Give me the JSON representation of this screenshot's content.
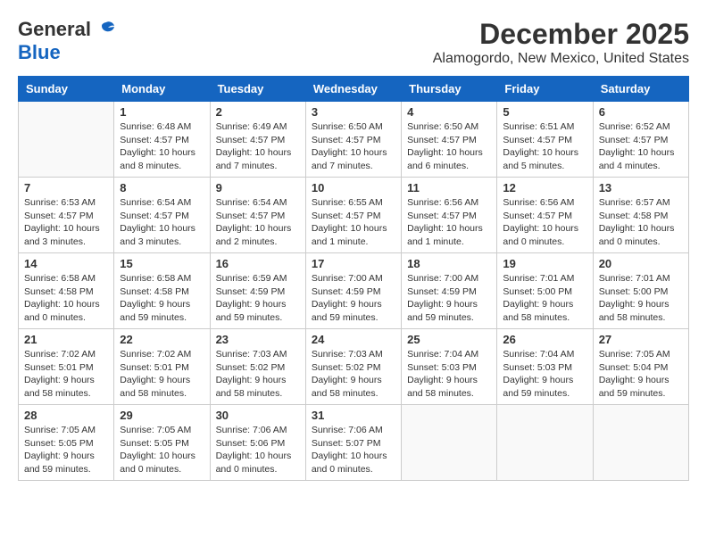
{
  "header": {
    "logo_general": "General",
    "logo_blue": "Blue",
    "month": "December 2025",
    "location": "Alamogordo, New Mexico, United States"
  },
  "days_of_week": [
    "Sunday",
    "Monday",
    "Tuesday",
    "Wednesday",
    "Thursday",
    "Friday",
    "Saturday"
  ],
  "weeks": [
    [
      {
        "day": "",
        "info": ""
      },
      {
        "day": "1",
        "info": "Sunrise: 6:48 AM\nSunset: 4:57 PM\nDaylight: 10 hours\nand 8 minutes."
      },
      {
        "day": "2",
        "info": "Sunrise: 6:49 AM\nSunset: 4:57 PM\nDaylight: 10 hours\nand 7 minutes."
      },
      {
        "day": "3",
        "info": "Sunrise: 6:50 AM\nSunset: 4:57 PM\nDaylight: 10 hours\nand 7 minutes."
      },
      {
        "day": "4",
        "info": "Sunrise: 6:50 AM\nSunset: 4:57 PM\nDaylight: 10 hours\nand 6 minutes."
      },
      {
        "day": "5",
        "info": "Sunrise: 6:51 AM\nSunset: 4:57 PM\nDaylight: 10 hours\nand 5 minutes."
      },
      {
        "day": "6",
        "info": "Sunrise: 6:52 AM\nSunset: 4:57 PM\nDaylight: 10 hours\nand 4 minutes."
      }
    ],
    [
      {
        "day": "7",
        "info": "Sunrise: 6:53 AM\nSunset: 4:57 PM\nDaylight: 10 hours\nand 3 minutes."
      },
      {
        "day": "8",
        "info": "Sunrise: 6:54 AM\nSunset: 4:57 PM\nDaylight: 10 hours\nand 3 minutes."
      },
      {
        "day": "9",
        "info": "Sunrise: 6:54 AM\nSunset: 4:57 PM\nDaylight: 10 hours\nand 2 minutes."
      },
      {
        "day": "10",
        "info": "Sunrise: 6:55 AM\nSunset: 4:57 PM\nDaylight: 10 hours\nand 1 minute."
      },
      {
        "day": "11",
        "info": "Sunrise: 6:56 AM\nSunset: 4:57 PM\nDaylight: 10 hours\nand 1 minute."
      },
      {
        "day": "12",
        "info": "Sunrise: 6:56 AM\nSunset: 4:57 PM\nDaylight: 10 hours\nand 0 minutes."
      },
      {
        "day": "13",
        "info": "Sunrise: 6:57 AM\nSunset: 4:58 PM\nDaylight: 10 hours\nand 0 minutes."
      }
    ],
    [
      {
        "day": "14",
        "info": "Sunrise: 6:58 AM\nSunset: 4:58 PM\nDaylight: 10 hours\nand 0 minutes."
      },
      {
        "day": "15",
        "info": "Sunrise: 6:58 AM\nSunset: 4:58 PM\nDaylight: 9 hours\nand 59 minutes."
      },
      {
        "day": "16",
        "info": "Sunrise: 6:59 AM\nSunset: 4:59 PM\nDaylight: 9 hours\nand 59 minutes."
      },
      {
        "day": "17",
        "info": "Sunrise: 7:00 AM\nSunset: 4:59 PM\nDaylight: 9 hours\nand 59 minutes."
      },
      {
        "day": "18",
        "info": "Sunrise: 7:00 AM\nSunset: 4:59 PM\nDaylight: 9 hours\nand 59 minutes."
      },
      {
        "day": "19",
        "info": "Sunrise: 7:01 AM\nSunset: 5:00 PM\nDaylight: 9 hours\nand 58 minutes."
      },
      {
        "day": "20",
        "info": "Sunrise: 7:01 AM\nSunset: 5:00 PM\nDaylight: 9 hours\nand 58 minutes."
      }
    ],
    [
      {
        "day": "21",
        "info": "Sunrise: 7:02 AM\nSunset: 5:01 PM\nDaylight: 9 hours\nand 58 minutes."
      },
      {
        "day": "22",
        "info": "Sunrise: 7:02 AM\nSunset: 5:01 PM\nDaylight: 9 hours\nand 58 minutes."
      },
      {
        "day": "23",
        "info": "Sunrise: 7:03 AM\nSunset: 5:02 PM\nDaylight: 9 hours\nand 58 minutes."
      },
      {
        "day": "24",
        "info": "Sunrise: 7:03 AM\nSunset: 5:02 PM\nDaylight: 9 hours\nand 58 minutes."
      },
      {
        "day": "25",
        "info": "Sunrise: 7:04 AM\nSunset: 5:03 PM\nDaylight: 9 hours\nand 58 minutes."
      },
      {
        "day": "26",
        "info": "Sunrise: 7:04 AM\nSunset: 5:03 PM\nDaylight: 9 hours\nand 59 minutes."
      },
      {
        "day": "27",
        "info": "Sunrise: 7:05 AM\nSunset: 5:04 PM\nDaylight: 9 hours\nand 59 minutes."
      }
    ],
    [
      {
        "day": "28",
        "info": "Sunrise: 7:05 AM\nSunset: 5:05 PM\nDaylight: 9 hours\nand 59 minutes."
      },
      {
        "day": "29",
        "info": "Sunrise: 7:05 AM\nSunset: 5:05 PM\nDaylight: 10 hours\nand 0 minutes."
      },
      {
        "day": "30",
        "info": "Sunrise: 7:06 AM\nSunset: 5:06 PM\nDaylight: 10 hours\nand 0 minutes."
      },
      {
        "day": "31",
        "info": "Sunrise: 7:06 AM\nSunset: 5:07 PM\nDaylight: 10 hours\nand 0 minutes."
      },
      {
        "day": "",
        "info": ""
      },
      {
        "day": "",
        "info": ""
      },
      {
        "day": "",
        "info": ""
      }
    ]
  ]
}
